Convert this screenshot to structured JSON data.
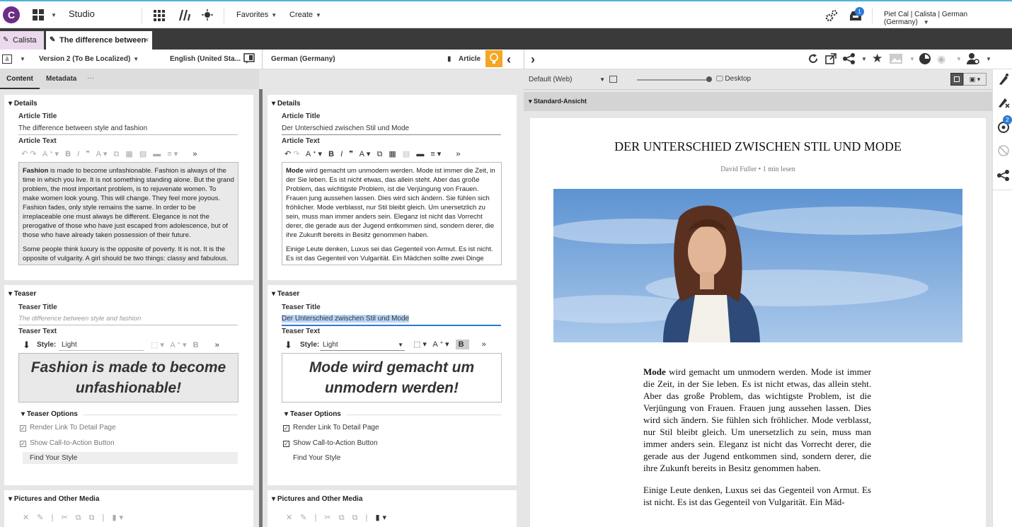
{
  "topbar": {
    "logo": "C",
    "app_name": "Studio",
    "favorites": "Favorites",
    "create": "Create",
    "notification_count": "1",
    "user": "Piet Cal | Calista | German (Germany)"
  },
  "tabs": [
    {
      "label": "Calista"
    },
    {
      "label": "The difference between ..."
    }
  ],
  "toolbar": {
    "version": "Version 2 (To Be Localized)",
    "source_locale": "English (United Sta...",
    "target_locale": "German (Germany)",
    "doc_type": "Article"
  },
  "preview_toolbar": {
    "device": "Default (Web)",
    "view": "Desktop",
    "section": "Standard-Ansicht"
  },
  "subtabs": {
    "content": "Content",
    "metadata": "Metadata",
    "more": "···"
  },
  "source": {
    "details_header": "Details",
    "article_title_label": "Article Title",
    "article_title": "The difference between style and fashion",
    "article_text_label": "Article Text",
    "text_bold": "Fashion",
    "text_p1": " is made to become unfashionable. Fashion is always of the time in which you live. It is not something standing alone. But the grand problem, the most important problem, is to rejuvenate women. To make women look young. This will change. They feel more joyous. Fashion fades, only style remains the same. In order to be irreplaceable one must always be different. Elegance is not the prerogative of those who have just escaped from adolescence, but of those who have already taken possession of their future.",
    "text_p2": "Some people think luxury is the opposite of poverty. It is not. It is the opposite of vulgarity. A girl should be two things: classy and fabulous.",
    "teaser_header": "Teaser",
    "teaser_title_label": "Teaser Title",
    "teaser_title": "The difference between style and fashion",
    "teaser_text_label": "Teaser Text",
    "style_label": "Style:",
    "style_value": "Light",
    "teaser_big": "Fashion is made to become unfashionable!",
    "teaser_options": "Teaser Options",
    "opt1": "Render Link To Detail Page",
    "opt2": "Show Call-to-Action Button",
    "cta": "Find Your Style",
    "media_header": "Pictures and Other Media"
  },
  "target": {
    "details_header": "Details",
    "article_title_label": "Article Title",
    "article_title": "Der Unterschied zwischen Stil und Mode",
    "article_text_label": "Article Text",
    "text_bold": "Mode",
    "text_p1": " wird gemacht um unmodern werden. Mode ist immer die Zeit, in der Sie leben. Es ist nicht etwas, das allein steht. Aber das große Problem, das wichtigste Problem, ist die Verjüngung von Frauen. Frauen jung aussehen lassen. Dies wird sich ändern. Sie fühlen sich fröhlicher. Mode verblasst, nur Stil bleibt gleich. Um unersetzlich zu sein, muss man immer anders sein. Eleganz ist nicht das Vorrecht derer, die gerade aus der Jugend entkommen sind, sondern derer, die ihre Zukunft bereits in Besitz genommen haben.",
    "text_p2": "Einige Leute denken, Luxus sei das Gegenteil von Armut. Es ist nicht. Es ist das Gegenteil von Vulgarität. Ein Mädchen sollte zwei Dinge",
    "teaser_header": "Teaser",
    "teaser_title_label": "Teaser Title",
    "teaser_title": "Der Unterschied zwischen Stil und Mode",
    "teaser_text_label": "Teaser Text",
    "style_label": "Style:",
    "style_value": "Light",
    "teaser_big": "Mode wird gemacht um unmodern werden!",
    "teaser_options": "Teaser Options",
    "opt1": "Render Link To Detail Page",
    "opt2": "Show Call-to-Action Button",
    "cta": "Find Your Style",
    "media_header": "Pictures and Other Media"
  },
  "preview": {
    "headline": "DER UNTERSCHIED ZWISCHEN STIL UND MODE",
    "byline": "David Fuller • 1 min lesen",
    "body_bold": "Mode",
    "body_p1": " wird gemacht um unmodern werden. Mode ist immer die Zeit, in der Sie leben. Es ist nicht etwas, das allein steht. Aber das große Problem, das wichtigste Problem, ist die Verjüngung von Frauen. Frauen jung aussehen lassen. Dies wird sich ändern. Sie fühlen sich fröhlicher. Mode verblasst, nur Stil bleibt gleich. Um unersetzlich zu sein, muss man immer anders sein. Eleganz ist nicht das Vorrecht derer, die gerade aus der Jugend entkommen sind, sondern derer, die ihre Zukunft bereits in Besitz genommen haben.",
    "body_p2": "Einige Leute denken, Luxus sei das Gegenteil von Armut. Es ist nicht. Es ist das Gegenteil von Vulgarität. Ein Mäd-"
  },
  "sidebar_badge": "2",
  "colors": {
    "accent_top": "#4fb3d9",
    "logo": "#6b2d86",
    "tab_active": "#ead9ec",
    "bulb": "#f5a623",
    "badge": "#2b7bd6"
  }
}
